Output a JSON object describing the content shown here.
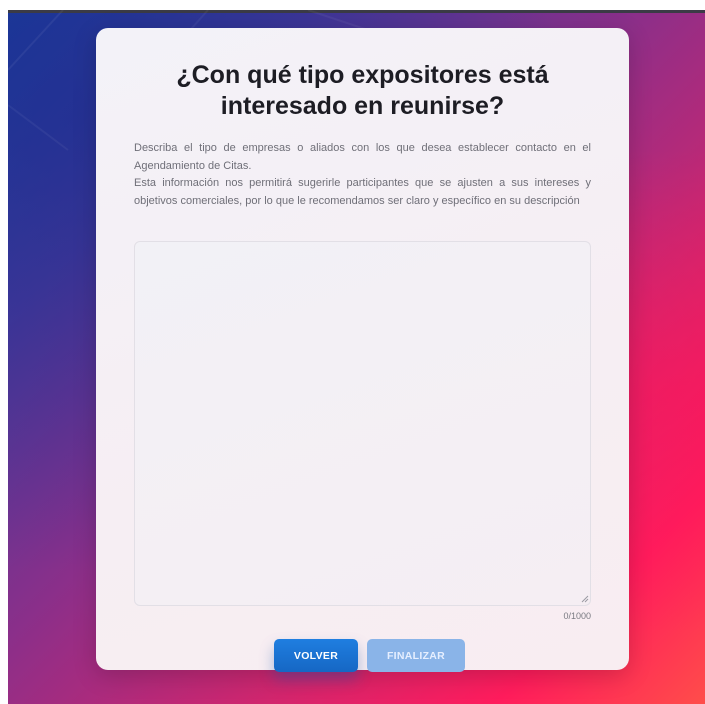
{
  "page": {
    "title": "¿Con qué tipo expositores está interesado en reunirse?",
    "description_line1": "Describa el tipo de empresas o aliados con los que desea establecer contacto en el Agendamiento de Citas.",
    "description_line2": "Esta información nos permitirá sugerirle participantes que se ajusten a sus intereses y objetivos comerciales, por lo que le recomendamos ser claro y específico en su descripción"
  },
  "form": {
    "textarea_value": "",
    "char_count": "0/1000"
  },
  "buttons": {
    "back_label": "VOLVER",
    "finish_label": "FINALIZAR"
  },
  "colors": {
    "primary_button": "#1a72d4",
    "disabled_button": "#8ab4e8",
    "card_background": "#f4f0f5",
    "title_text": "#1d1d24"
  },
  "icons": {
    "resize_handle": "textarea-resize-icon"
  }
}
